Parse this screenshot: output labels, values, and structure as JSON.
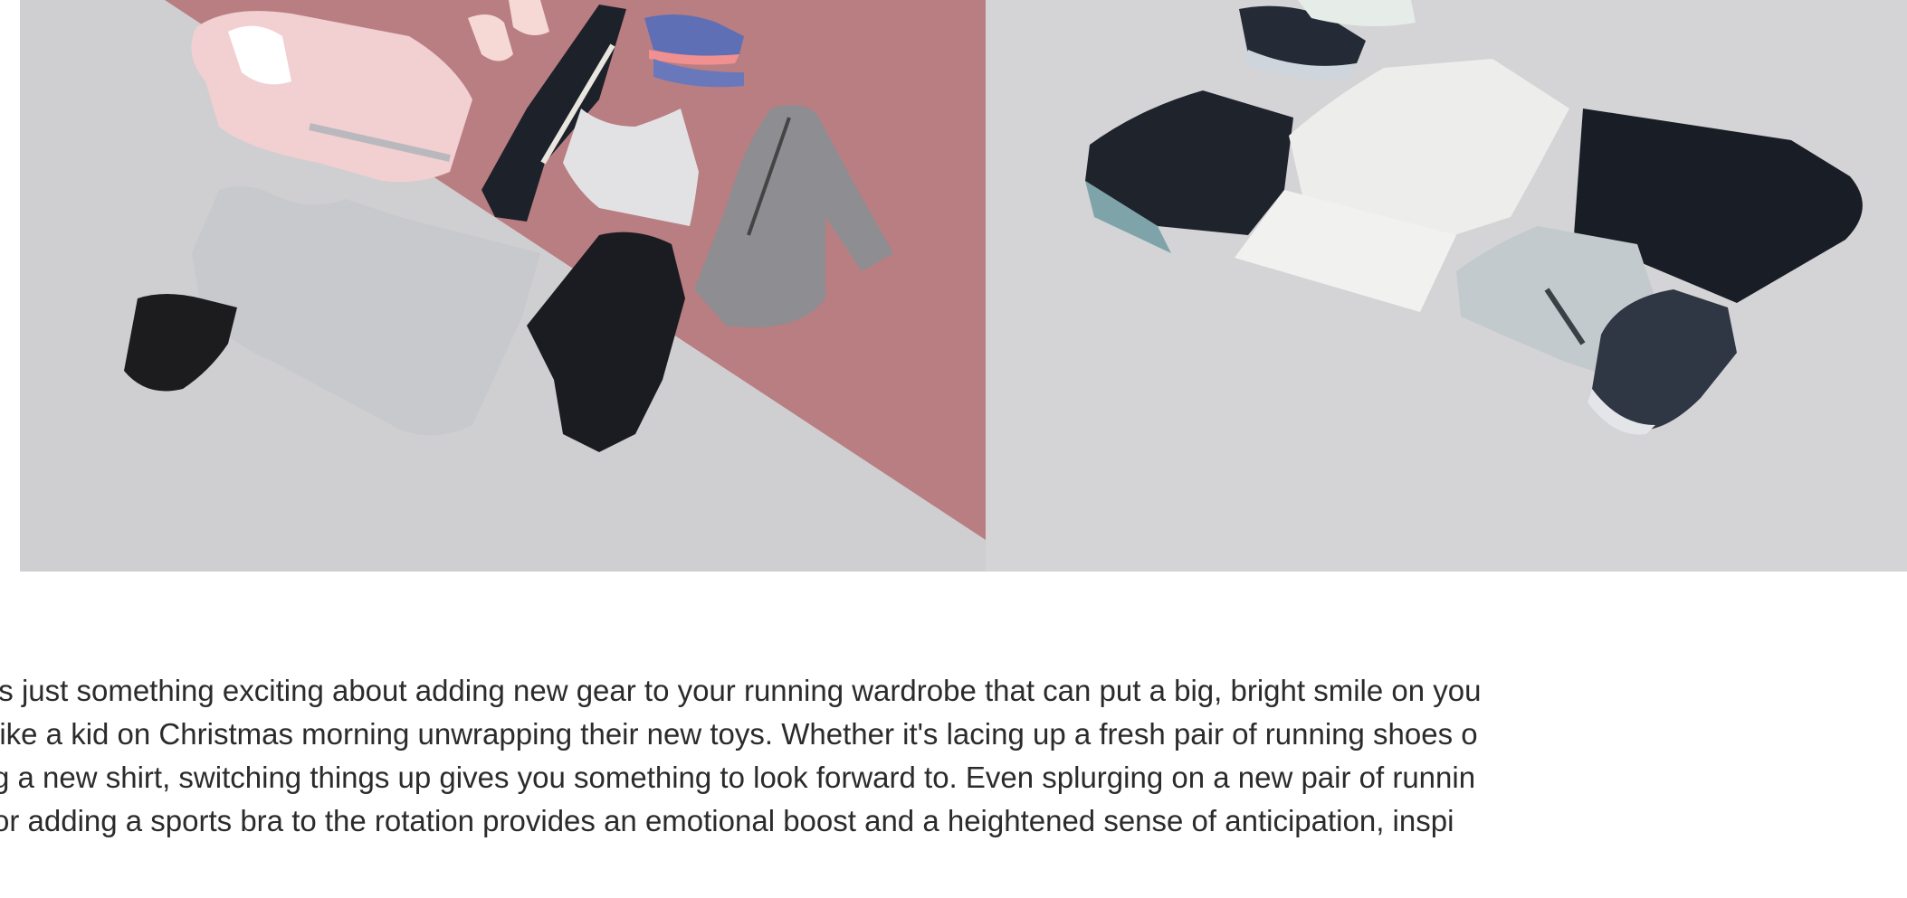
{
  "hero": {
    "left_panel": {
      "items": [
        "hoodie",
        "socks",
        "leggings",
        "running-shoes",
        "sports-bra",
        "quarter-zip",
        "tank-top",
        "visor",
        "tights"
      ],
      "colors": {
        "background": "#cfcfd1",
        "accent": "#b97e82"
      }
    },
    "right_panel": {
      "items": [
        "shoes-pair",
        "shorts",
        "tshirt",
        "folded-tee",
        "track-pants",
        "jacket",
        "shoe"
      ],
      "colors": {
        "background": "#d4d4d6"
      }
    }
  },
  "article": {
    "lines": [
      "'s just something exciting about adding new gear to your running wardrobe that can put a big, bright smile on you",
      "like a kid on Christmas morning unwrapping their new toys. Whether it's lacing up a fresh pair of running shoes o",
      "g a new shirt, switching things up gives you something to look forward to. Even splurging on a new pair of runnin",
      " or adding a sports bra to the rotation provides an emotional boost and a heightened sense of anticipation, inspi"
    ]
  }
}
